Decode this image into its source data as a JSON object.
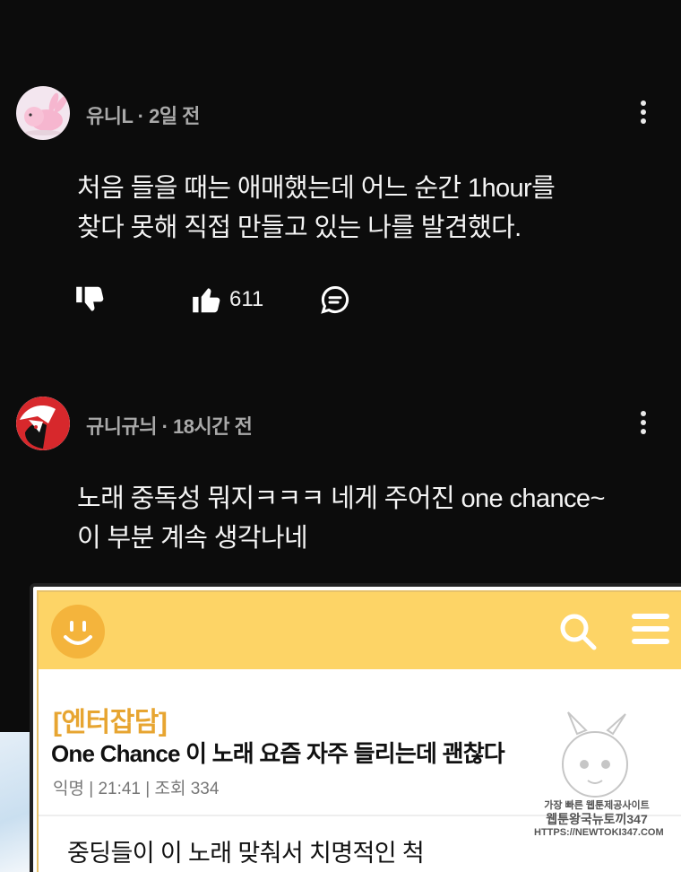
{
  "comments": [
    {
      "author": "유니L",
      "time": "2일 전",
      "text_lines": [
        "처음 들을 때는 애매했는데 어느 순간 1hour를",
        "찾다 못해 직접 만들고 있는 나를 발견했다."
      ],
      "likes": "611"
    },
    {
      "author": "규니규늬",
      "time": "18시간 전",
      "text_lines": [
        "노래 중독성 뭐지ㅋㅋㅋ 네게 주어진 one chance~",
        "이 부분 계속 생각나네"
      ]
    }
  ],
  "embed": {
    "category": "[엔터잡담]",
    "title": "One Chance 이 노래 요즘 자주 들리는데 괜찮다",
    "meta": "익명 | 21:41 | 조회 334",
    "body_line": "중딩들이 이 노래 맞춰서 치명적인 척"
  },
  "watermark": {
    "line1": "가장 빠른 웹툰제공사이트",
    "line2": "웹툰왕국뉴토끼347",
    "line3": "HTTPS://NEWTOKI347.COM"
  },
  "icons": [
    "kebab-menu-icon",
    "thumbs-down-icon",
    "thumbs-up-icon",
    "reply-icon",
    "smiley-logo-icon",
    "search-icon",
    "hamburger-menu-icon"
  ],
  "colors": {
    "background": "#0c0c0c",
    "header_yellow": "#fdd466",
    "category_orange": "#e7a531"
  }
}
